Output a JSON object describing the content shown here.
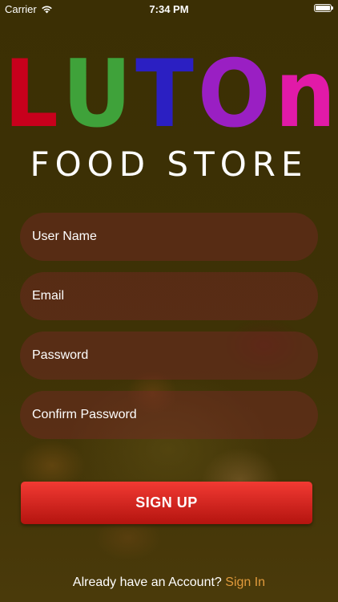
{
  "status_bar": {
    "carrier": "Carrier",
    "time": "7:34 PM",
    "battery_level": 1.0
  },
  "logo": {
    "letters": [
      {
        "char": "L",
        "color": "#c8001c"
      },
      {
        "char": "U",
        "color": "#3fa23a"
      },
      {
        "char": "T",
        "color": "#2b1fc2"
      },
      {
        "char": "O",
        "color": "#9a1fc3"
      },
      {
        "char": "n",
        "color": "#e11aa8"
      }
    ],
    "subtitle": "FOOD STORE"
  },
  "form": {
    "username_placeholder": "User Name",
    "email_placeholder": "Email",
    "password_placeholder": "Password",
    "confirm_password_placeholder": "Confirm Password"
  },
  "signup_button": "SIGN UP",
  "footer": {
    "prompt": "Already have an Account?",
    "signin_link": "Sign In"
  }
}
